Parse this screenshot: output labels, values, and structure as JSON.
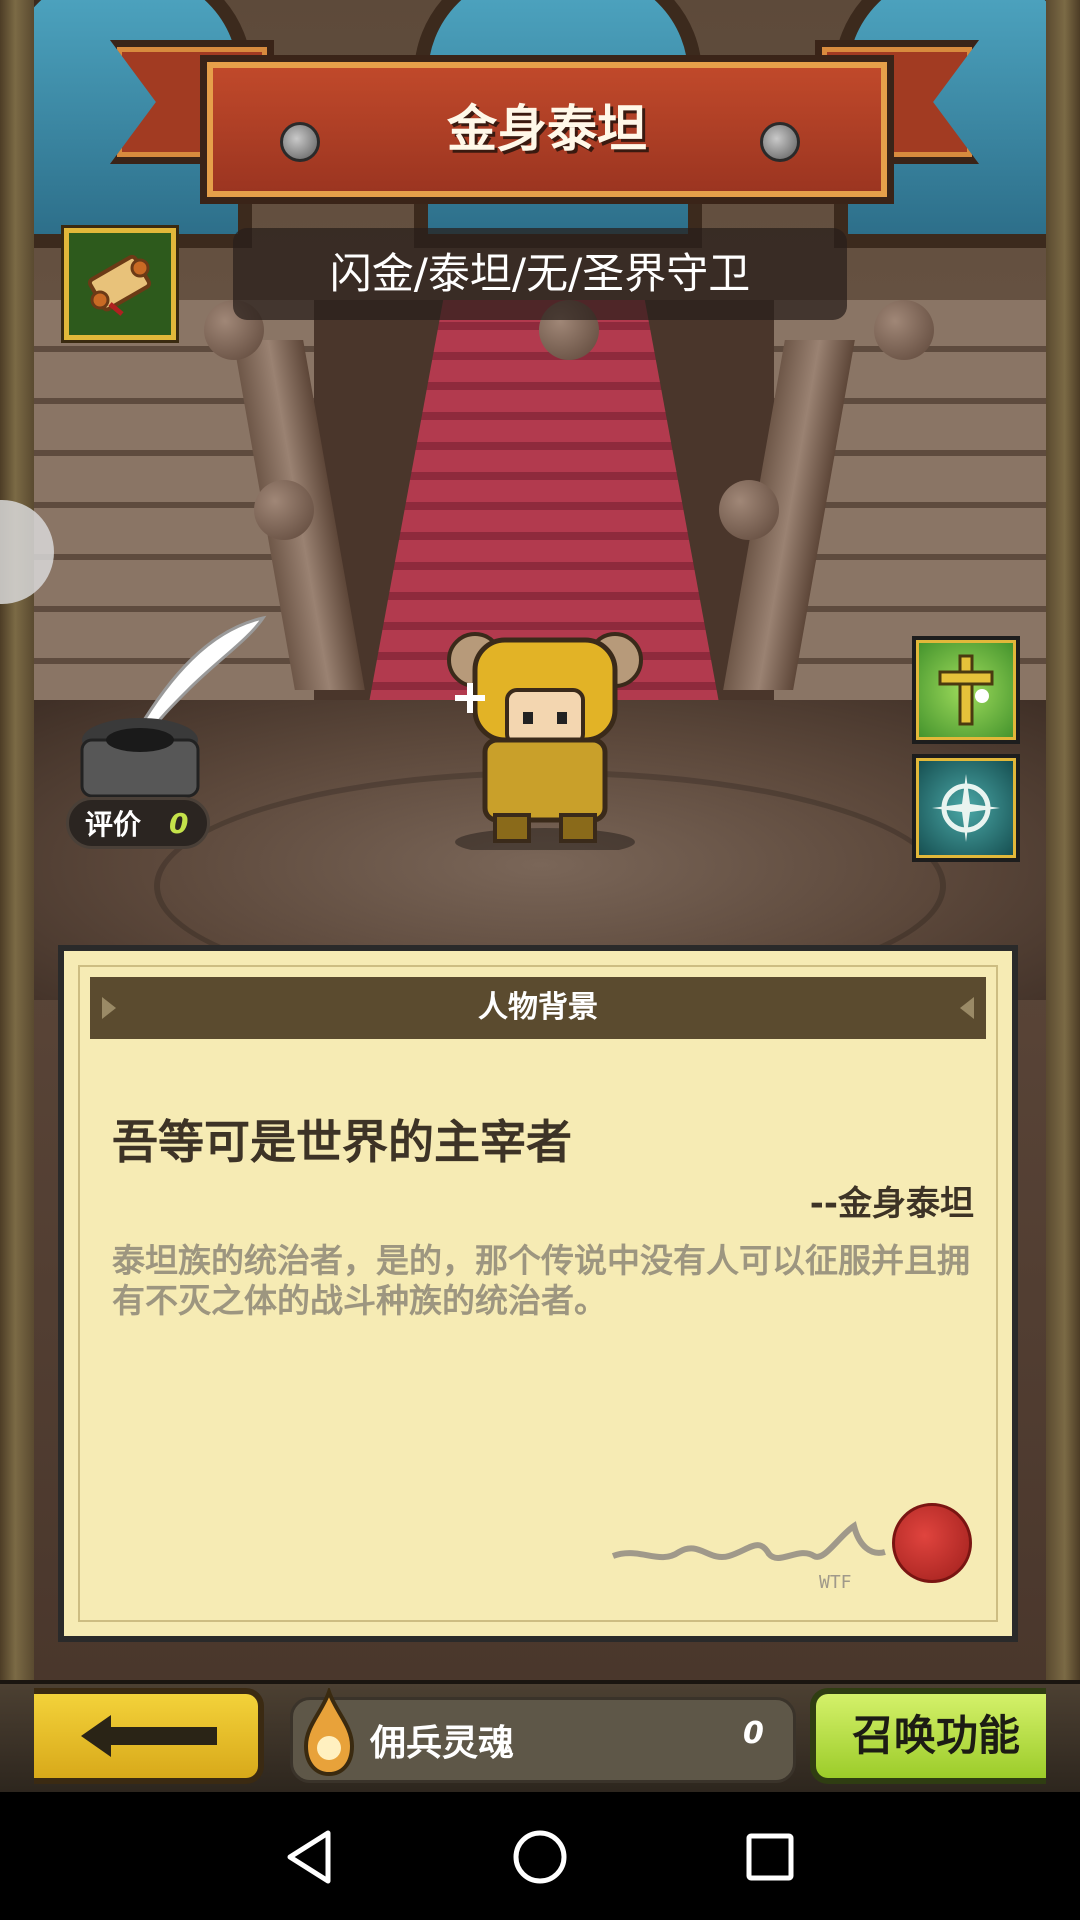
{
  "header": {
    "title": "金身泰坦",
    "subtitle": "闪金/泰坦/无/圣界守卫"
  },
  "icons": {
    "scroll": "scroll-icon",
    "inkwell": "inkwell-icon",
    "skill_1": "holy-cross-skill-icon",
    "skill_2": "compass-sigil-skill-icon",
    "back": "arrow-left-icon",
    "soul": "soul-flame-icon",
    "signature": "signature-icon",
    "seal": "wax-seal-icon"
  },
  "rating": {
    "label": "评价",
    "value": "0"
  },
  "background_panel": {
    "heading": "人物背景",
    "quote": "吾等可是世界的主宰者",
    "speaker": "--金身泰坦",
    "bio": "泰坦族的统治者，是的，那个传说中没有人可以征服并且拥有不灭之体的战斗种族的统治者。",
    "signature_mark": "WTF"
  },
  "bottom_bar": {
    "soul_label": "佣兵灵魂",
    "soul_count": "0",
    "summon_label": "召唤功能"
  },
  "colors": {
    "banner": "#b6412a",
    "parchment": "#f6ebb4",
    "back_button": "#f0c92c",
    "summon_button": "#b9e04a",
    "rating_value": "#c4e24a"
  }
}
